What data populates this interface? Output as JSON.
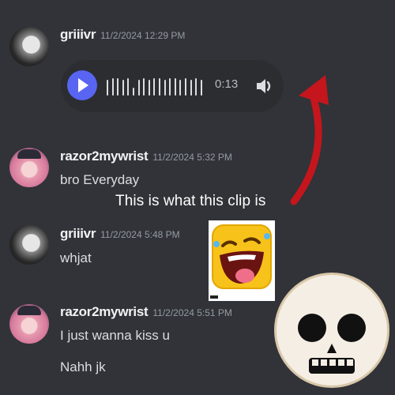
{
  "messages": [
    {
      "username": "griiivr",
      "timestamp": "11/2/2024 12:29 PM",
      "text": ""
    },
    {
      "username": "razor2mywrist",
      "timestamp": "11/2/2024 5:32 PM",
      "text": "bro Everyday"
    },
    {
      "username": "griiivr",
      "timestamp": "11/2/2024 5:48 PM",
      "text": "whjat"
    },
    {
      "username": "razor2mywrist",
      "timestamp": "11/2/2024 5:51 PM",
      "text": "I just wanna kiss u",
      "text2": "Nahh jk"
    }
  ],
  "voice_message": {
    "duration": "0:13",
    "progress": 0
  },
  "overlay": {
    "caption": "This is what this clip is"
  },
  "icons": {
    "play": "play-icon",
    "volume": "volume-icon",
    "arrow": "red-curved-arrow",
    "laugh": "laughing-emoji",
    "skull": "skull-emoji"
  },
  "colors": {
    "background": "#313338",
    "accent": "#5865f2",
    "arrow": "#c4161c"
  }
}
